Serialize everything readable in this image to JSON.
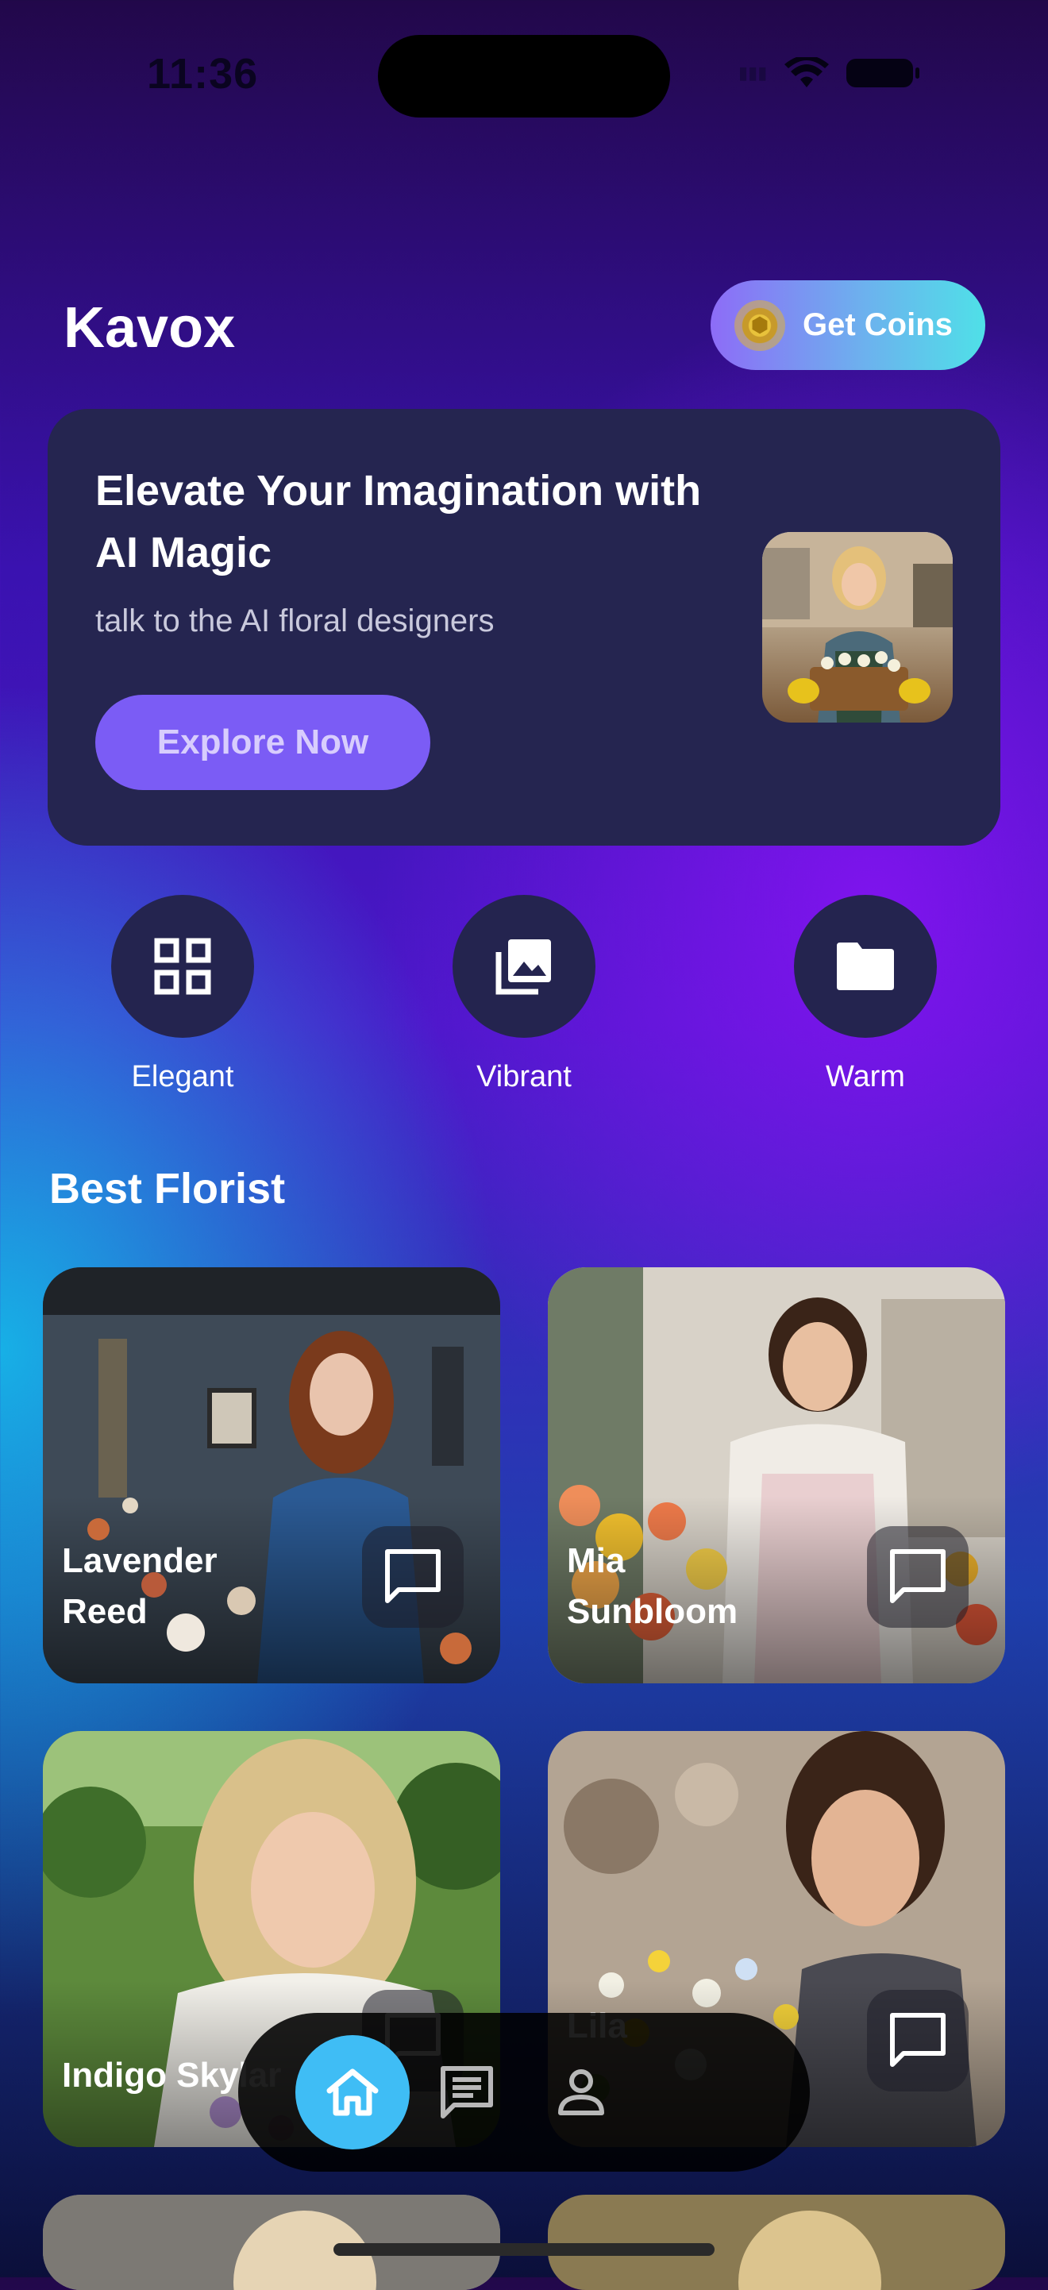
{
  "status_bar": {
    "time": "11:36"
  },
  "header": {
    "title": "Kavox",
    "coins_button": "Get Coins"
  },
  "hero": {
    "title": "Elevate Your Imagination with AI Magic",
    "subtitle": "talk to the AI floral designers",
    "button": "Explore Now"
  },
  "categories": [
    {
      "label": "Elegant",
      "icon": "grid-icon"
    },
    {
      "label": "Vibrant",
      "icon": "photo-library-icon"
    },
    {
      "label": "Warm",
      "icon": "folder-icon"
    }
  ],
  "section": {
    "title": "Best Florist"
  },
  "florists": [
    {
      "name": "Lavender Reed"
    },
    {
      "name": "Mia Sunbloom"
    },
    {
      "name": "Indigo Skylar"
    },
    {
      "name": "Lila"
    }
  ],
  "tabs": [
    {
      "icon": "home-icon",
      "active": true
    },
    {
      "icon": "chat-list-icon",
      "active": false
    },
    {
      "icon": "person-icon",
      "active": false
    }
  ],
  "colors": {
    "accent": "#7b5cf5",
    "tab_active": "#3fbdf5",
    "card_bg": "#252550"
  }
}
